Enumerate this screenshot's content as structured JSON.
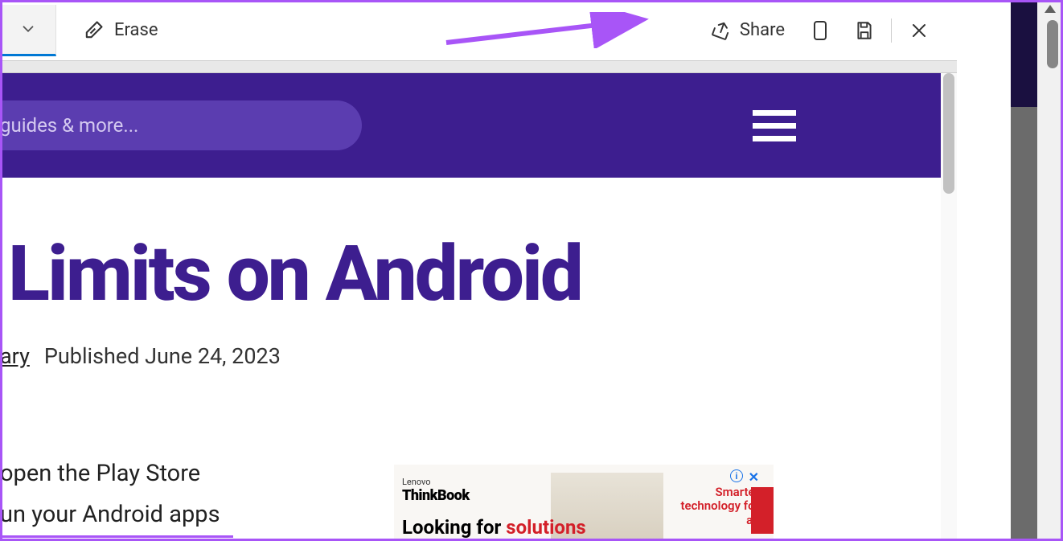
{
  "toolbar": {
    "erase_label": "Erase",
    "share_label": "Share"
  },
  "site": {
    "search_placeholder": "guides & more..."
  },
  "article": {
    "title_fragment": "Limits on Android",
    "author_fragment": "ary",
    "published": "Published June 24, 2023",
    "body_line1": "open the Play Store",
    "body_line2": "un your Android apps"
  },
  "ad": {
    "brand_small": "Lenovo",
    "brand_big": "ThinkBook",
    "headline_plain": "Looking for ",
    "headline_red": "solutions",
    "tagline": "Smarter technology for all",
    "info_symbol": "i",
    "close_symbol": "✕"
  }
}
